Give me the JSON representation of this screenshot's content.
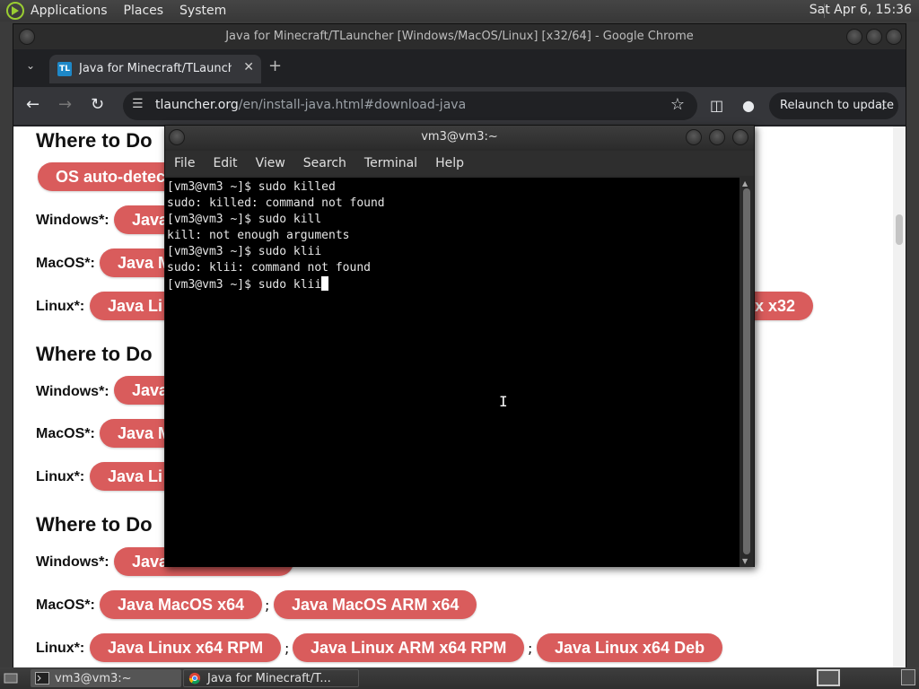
{
  "top_panel": {
    "menus": [
      "Applications",
      "Places",
      "System"
    ],
    "clock": "Sat Apr  6, 15:36"
  },
  "chrome": {
    "window_title": "Java for Minecraft/TLauncher [Windows/MacOS/Linux] [x32/64] - Google Chrome",
    "tab": {
      "favicon_text": "TL",
      "title": "Java for Minecraft/TLauncher"
    },
    "url": {
      "host": "tlauncher.org",
      "path": "/en/install-java.html#download-java"
    },
    "relaunch_label": "Relaunch to update"
  },
  "page": {
    "sections": [
      {
        "heading": "Where to Do",
        "auto_detect": "OS auto-detec",
        "rows": [
          {
            "label": "Windows*:",
            "pills": [
              "Java"
            ]
          },
          {
            "label": "MacOS*:",
            "pills": [
              "Java M"
            ]
          },
          {
            "label": "Linux*:",
            "pills": [
              "Java Li",
              "x x32"
            ]
          }
        ]
      },
      {
        "heading": "Where to Do",
        "rows": [
          {
            "label": "Windows*:",
            "pills": [
              "Java"
            ]
          },
          {
            "label": "MacOS*:",
            "pills": [
              "Java M"
            ]
          },
          {
            "label": "Linux*:",
            "pills": [
              "Java Li"
            ]
          }
        ]
      },
      {
        "heading": "Where to Do",
        "rows": [
          {
            "label": "Windows*:",
            "pills": [
              "Java"
            ]
          },
          {
            "label": "MacOS*:",
            "pills": [
              "Java MacOS x64",
              "Java MacOS ARM x64"
            ]
          },
          {
            "label": "Linux*:",
            "pills": [
              "Java Linux x64 RPM",
              "Java Linux ARM x64 RPM",
              "Java Linux x64 Deb"
            ]
          }
        ]
      }
    ],
    "separator": ";"
  },
  "terminal": {
    "title": "vm3@vm3:~",
    "menus": [
      "File",
      "Edit",
      "View",
      "Search",
      "Terminal",
      "Help"
    ],
    "lines": [
      "[vm3@vm3 ~]$ sudo killed",
      "sudo: killed: command not found",
      "[vm3@vm3 ~]$ sudo kill",
      "kill: not enough arguments",
      "[vm3@vm3 ~]$ sudo klii",
      "sudo: klii: command not found",
      "[vm3@vm3 ~]$ sudo klii"
    ]
  },
  "taskbar": {
    "tasks": [
      "vm3@vm3:~",
      "Java for Minecraft/T..."
    ]
  },
  "colors": {
    "pill": "#d95c5c",
    "chrome_bg": "#202124",
    "toolbar": "#35363a"
  },
  "icons": [
    "distro-logo-icon",
    "back-arrow-icon",
    "forward-arrow-icon",
    "reload-icon",
    "site-settings-icon",
    "bookmark-star-icon",
    "side-panel-icon",
    "profile-icon",
    "kebab-menu-icon",
    "terminal-icon",
    "chrome-icon",
    "workspace-icon",
    "trash-icon"
  ]
}
